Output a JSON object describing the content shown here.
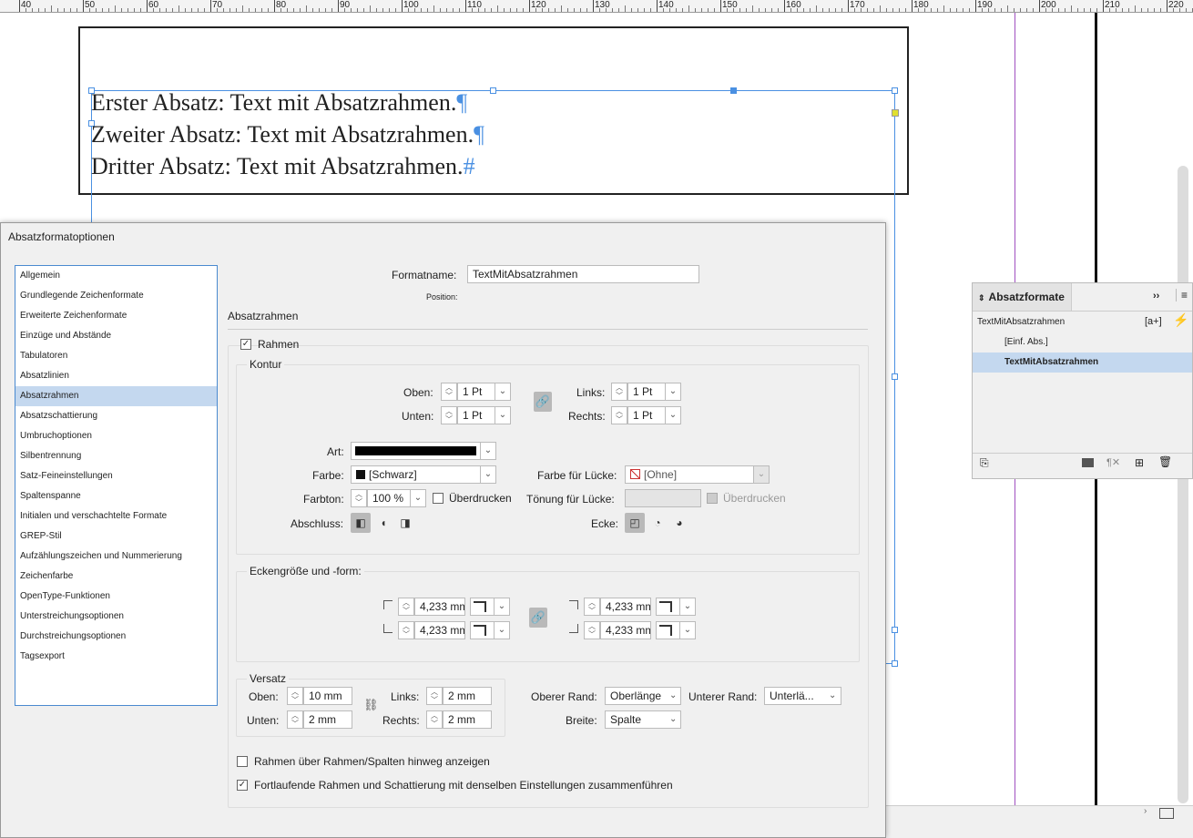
{
  "ruler": {
    "labels": [
      "40",
      "50",
      "60",
      "70",
      "80",
      "90",
      "100",
      "110",
      "120",
      "130",
      "140",
      "150",
      "160",
      "170",
      "180",
      "190",
      "200",
      "210",
      "220"
    ]
  },
  "document": {
    "lines": [
      {
        "text": "Erster Absatz: Text mit Absatzrahmen.",
        "mark": "¶"
      },
      {
        "text": "Zweiter Absatz: Text mit Absatzrahmen.",
        "mark": "¶"
      },
      {
        "text": "Dritter Absatz: Text mit Absatzrahmen.",
        "mark": "#"
      }
    ]
  },
  "dialog": {
    "title": "Absatzformatoptionen",
    "categories": [
      "Allgemein",
      "Grundlegende Zeichenformate",
      "Erweiterte Zeichenformate",
      "Einzüge und Abstände",
      "Tabulatoren",
      "Absatzlinien",
      "Absatzrahmen",
      "Absatzschattierung",
      "Umbruchoptionen",
      "Silbentrennung",
      "Satz-Feineinstellungen",
      "Spaltenspanne",
      "Initialen und verschachtelte Formate",
      "GREP-Stil",
      "Aufzählungszeichen und Nummerierung",
      "Zeichenfarbe",
      "OpenType-Funktionen",
      "Unterstreichungsoptionen",
      "Durchstreichungsoptionen",
      "Tagsexport"
    ],
    "selected_category": "Absatzrahmen",
    "format_name_label": "Formatname:",
    "format_name": "TextMitAbsatzrahmen",
    "position_label": "Position:",
    "section_title": "Absatzrahmen",
    "rahmen_label": "Rahmen",
    "kontur": {
      "title": "Kontur",
      "oben_label": "Oben:",
      "oben": "1 Pt",
      "unten_label": "Unten:",
      "unten": "1 Pt",
      "links_label": "Links:",
      "links": "1 Pt",
      "rechts_label": "Rechts:",
      "rechts": "1 Pt",
      "art_label": "Art:",
      "farbe_label": "Farbe:",
      "farbe": "[Schwarz]",
      "farbton_label": "Farbton:",
      "farbton": "100 %",
      "ueberdrucken": "Überdrucken",
      "abschluss_label": "Abschluss:",
      "farbe_luecke_label": "Farbe für Lücke:",
      "farbe_luecke": "[Ohne]",
      "toenung_luecke_label": "Tönung für Lücke:",
      "ueberdrucken2": "Überdrucken",
      "ecke_label": "Ecke:"
    },
    "ecken": {
      "title": "Eckengröße und -form:",
      "tl": "4,233 mm",
      "bl": "4,233 mm",
      "tr": "4,233 mm",
      "br": "4,233 mm"
    },
    "versatz": {
      "title": "Versatz",
      "oben_label": "Oben:",
      "oben": "10 mm",
      "unten_label": "Unten:",
      "unten": "2 mm",
      "links_label": "Links:",
      "links": "2 mm",
      "rechts_label": "Rechts:",
      "rechts": "2 mm",
      "oberer_rand_label": "Oberer Rand:",
      "oberer_rand": "Oberlänge",
      "unterer_rand_label": "Unterer Rand:",
      "unterer_rand": "Unterlä...",
      "breite_label": "Breite:",
      "breite": "Spalte"
    },
    "option1": "Rahmen über Rahmen/Spalten hinweg anzeigen",
    "option1_checked": false,
    "option2": "Fortlaufende Rahmen und Schattierung mit denselben Einstellungen zusammenführen",
    "option2_checked": true
  },
  "panel": {
    "title": "Absatzformate",
    "current": "TextMitAbsatzrahmen",
    "new_from_selection": "[a+]",
    "items": [
      "[Einf. Abs.]",
      "TextMitAbsatzrahmen"
    ],
    "selected": "TextMitAbsatzrahmen"
  },
  "colors": {
    "accent": "#4a90e2",
    "selection": "#c4d8ef",
    "magenta_guide": "#a050c0"
  }
}
